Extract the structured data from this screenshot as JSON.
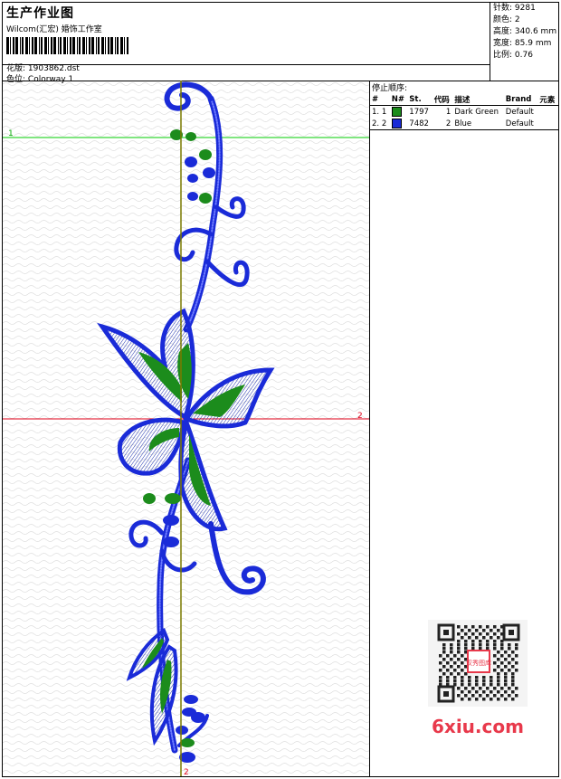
{
  "header": {
    "title": "生产作业图",
    "subtitle": "Wilcom(汇宏) 婚饰工作室",
    "pattern_label": "花版:",
    "pattern_value": "1903862.dst",
    "colorway_label": "色位:",
    "colorway_value": "Colorway 1"
  },
  "stats": [
    {
      "label": "针数:",
      "value": "9281"
    },
    {
      "label": "颜色:",
      "value": "2"
    },
    {
      "label": "高度:",
      "value": "340.6 mm"
    },
    {
      "label": "宽度:",
      "value": "85.9 mm"
    },
    {
      "label": "比例:",
      "value": "0.76"
    }
  ],
  "stop_sequence": {
    "title": "停止顺序:",
    "columns": [
      "#",
      "N#",
      "St.",
      "代码",
      "描述",
      "Brand",
      "元素"
    ],
    "rows": [
      {
        "num": "1.",
        "n": "1",
        "color": "#1c8c1c",
        "stitches": "1797",
        "code": "1",
        "desc": "Dark Green",
        "brand": "Default",
        "element": ""
      },
      {
        "num": "2.",
        "n": "2",
        "color": "#1a2bd8",
        "stitches": "7482",
        "code": "2",
        "desc": "Blue",
        "brand": "Default",
        "element": ""
      }
    ]
  },
  "markers": {
    "stop1": "1",
    "stop2": "2",
    "stop2_bottom": "2"
  },
  "watermark": {
    "text": "6xiu.com",
    "seal": "汉秀图库"
  },
  "colors": {
    "blue": "#1a2bd8",
    "green": "#1c8c1c",
    "guide_green": "#00cc00",
    "guide_red": "#e0001a",
    "axis": "#7a7a00"
  }
}
